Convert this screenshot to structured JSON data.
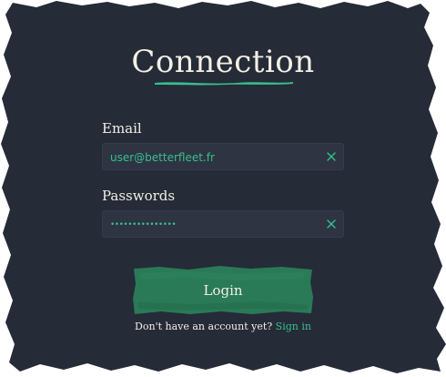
{
  "title": "Connection",
  "email": {
    "label": "Email",
    "value": "user@betterfleet.fr",
    "clear_icon": "close-icon"
  },
  "password": {
    "label": "Passwords",
    "value": "•••••••••••••••",
    "clear_icon": "close-icon"
  },
  "login": {
    "label": "Login"
  },
  "signup": {
    "prompt": "Don't have an account yet?",
    "link": "Sign in"
  },
  "colors": {
    "panel": "#252b37",
    "field": "#2e3442",
    "accent": "#36c08c",
    "button": "#2a7a57",
    "text": "#f3efe6"
  }
}
